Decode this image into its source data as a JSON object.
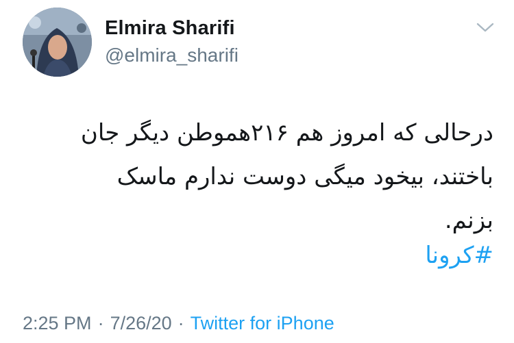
{
  "tweet": {
    "author": {
      "display_name": "Elmira Sharifi",
      "handle": "@elmira_sharifi"
    },
    "text_lines": [
      "درحالی که امروز هم ۲۱۶هموطن دیگر جان",
      "باختند، بیخود میگی دوست ندارم ماسک",
      "بزنم."
    ],
    "hashtag": "#کرونا",
    "time": "2:25 PM",
    "date": "7/26/20",
    "separator": "·",
    "source": "Twitter for iPhone"
  },
  "icons": {
    "menu": "chevron-down-icon"
  },
  "colors": {
    "text": "#14171a",
    "secondary": "#657786",
    "link": "#1da1f2"
  }
}
